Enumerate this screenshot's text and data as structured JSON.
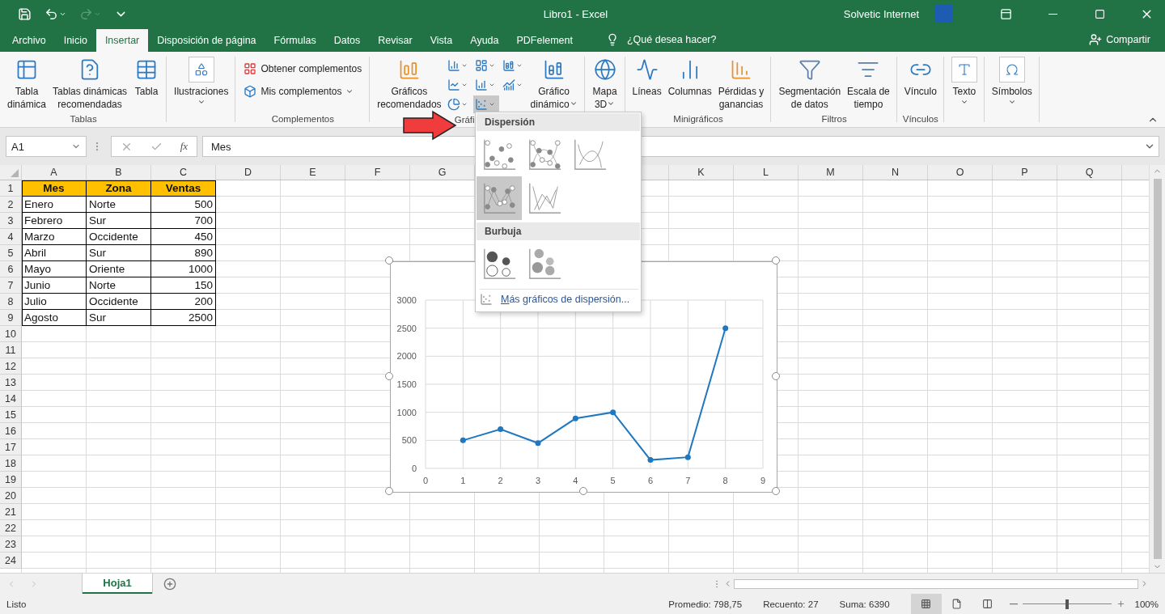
{
  "title_bar": {
    "title": "Libro1 - Excel",
    "user": "Solvetic Internet",
    "quick_access": [
      {
        "kind": "save",
        "disabled": false,
        "menu": false
      },
      {
        "kind": "undo",
        "disabled": false,
        "menu": true
      },
      {
        "kind": "redo",
        "disabled": true,
        "menu": true
      },
      {
        "kind": "customize",
        "disabled": false,
        "menu": false
      }
    ]
  },
  "tabs": [
    {
      "label": "Archivo",
      "selected": false
    },
    {
      "label": "Inicio",
      "selected": false
    },
    {
      "label": "Insertar",
      "selected": true
    },
    {
      "label": "Disposición de página",
      "selected": false
    },
    {
      "label": "Fórmulas",
      "selected": false
    },
    {
      "label": "Datos",
      "selected": false
    },
    {
      "label": "Revisar",
      "selected": false
    },
    {
      "label": "Vista",
      "selected": false
    },
    {
      "label": "Ayuda",
      "selected": false
    },
    {
      "label": "PDFelement",
      "selected": false
    }
  ],
  "tell_me": "¿Qué desea hacer?",
  "share": "Compartir",
  "ribbon": {
    "groups": [
      {
        "label": "Tablas",
        "items": [
          {
            "kind": "pivot-table",
            "label": "Tabla\ndinámica",
            "menu": false
          },
          {
            "kind": "recommended-pivot",
            "label": "Tablas dinámicas\nrecomendadas",
            "menu": false
          },
          {
            "kind": "table",
            "label": "Tabla",
            "menu": false
          }
        ]
      },
      {
        "items": [
          {
            "kind": "illustrations",
            "label": "Ilustraciones",
            "menu": true
          }
        ]
      },
      {
        "label": "Complementos",
        "items": [
          {
            "kind": "stack",
            "entries": [
              {
                "kind": "store",
                "label": "Obtener complementos",
                "menu": false
              },
              {
                "kind": "my-addins",
                "label": "Mis complementos",
                "menu": true
              }
            ]
          }
        ]
      },
      {
        "label": "Gráfi",
        "items": [
          {
            "kind": "recommended-charts",
            "label": "Gráficos\nrecomendados",
            "menu": false
          },
          {
            "kind": "chart-grid",
            "buttons": [
              {
                "kind": "column",
                "pressed": false
              },
              {
                "kind": "hierarchy",
                "pressed": false
              },
              {
                "kind": "waterfall",
                "pressed": false
              },
              {
                "kind": "line",
                "pressed": false
              },
              {
                "kind": "statistic",
                "pressed": false
              },
              {
                "kind": "combo",
                "pressed": false
              },
              {
                "kind": "pie",
                "pressed": false
              },
              {
                "kind": "scatter",
                "pressed": true
              }
            ]
          },
          {
            "kind": "pivot-chart",
            "label": "Gráfico\ndinámico",
            "menu": true
          }
        ]
      },
      {
        "items": [
          {
            "kind": "map-3d",
            "label": "Mapa\n3D",
            "menu": true
          }
        ]
      },
      {
        "label": "Minigráficos",
        "items": [
          {
            "kind": "sparkline-line",
            "label": "Líneas",
            "menu": false
          },
          {
            "kind": "sparkline-column",
            "label": "Columnas",
            "menu": false
          },
          {
            "kind": "win-loss",
            "label": "Pérdidas y\nganancias",
            "menu": false
          }
        ]
      },
      {
        "label": "Filtros",
        "items": [
          {
            "kind": "slicer",
            "label": "Segmentación\nde datos",
            "menu": false
          },
          {
            "kind": "timeline",
            "label": "Escala de\ntiempo",
            "menu": false
          }
        ]
      },
      {
        "label": "Vínculos",
        "items": [
          {
            "kind": "link",
            "label": "Vínculo",
            "menu": false
          }
        ]
      },
      {
        "items": [
          {
            "kind": "text",
            "label": "Texto",
            "menu": true
          }
        ]
      },
      {
        "items": [
          {
            "kind": "symbols",
            "label": "Símbolos",
            "menu": true
          }
        ]
      }
    ]
  },
  "formula_bar": {
    "name_box": "A1",
    "function_label": "fx",
    "value": "Mes"
  },
  "sheet": {
    "columns": [
      {
        "label": "A"
      },
      {
        "label": "B"
      },
      {
        "label": "C"
      },
      {
        "label": "D"
      },
      {
        "label": "E"
      },
      {
        "label": "F"
      },
      {
        "label": "G"
      },
      {},
      {},
      {},
      {
        "label": "K"
      },
      {
        "label": "L"
      },
      {
        "label": "M"
      },
      {
        "label": "N"
      },
      {
        "label": "O"
      },
      {
        "label": "P"
      },
      {
        "label": "Q"
      }
    ],
    "rows": [
      {
        "number": "1",
        "kind": "header",
        "cells": [
          "Mes",
          "Zona",
          "Ventas"
        ]
      },
      {
        "number": "2",
        "kind": "data",
        "cells": [
          "Enero",
          "Norte",
          "500"
        ]
      },
      {
        "number": "3",
        "kind": "data",
        "cells": [
          "Febrero",
          "Sur",
          "700"
        ]
      },
      {
        "number": "4",
        "kind": "data",
        "cells": [
          "Marzo",
          "Occidente",
          "450"
        ]
      },
      {
        "number": "5",
        "kind": "data",
        "cells": [
          "Abril",
          "Sur",
          "890"
        ]
      },
      {
        "number": "6",
        "kind": "data",
        "cells": [
          "Mayo",
          "Oriente",
          "1000"
        ]
      },
      {
        "number": "7",
        "kind": "data",
        "cells": [
          "Junio",
          "Norte",
          "150"
        ]
      },
      {
        "number": "8",
        "kind": "data",
        "cells": [
          "Julio",
          "Occidente",
          "200"
        ]
      },
      {
        "number": "9",
        "kind": "data",
        "cells": [
          "Agosto",
          "Sur",
          "2500"
        ]
      },
      {
        "number": "10"
      },
      {
        "number": "11"
      },
      {
        "number": "12"
      },
      {
        "number": "13"
      },
      {
        "number": "14"
      },
      {
        "number": "15"
      },
      {
        "number": "16"
      },
      {
        "number": "17"
      },
      {
        "number": "18"
      },
      {
        "number": "19"
      },
      {
        "number": "20"
      },
      {
        "number": "21"
      },
      {
        "number": "22"
      },
      {
        "number": "23"
      },
      {
        "number": "24"
      }
    ]
  },
  "chart": {
    "chart_data": {
      "type": "line",
      "x": [
        1,
        2,
        3,
        4,
        5,
        6,
        7,
        8
      ],
      "series": [
        {
          "color": "#1f77c0",
          "marker": true,
          "values": [
            500,
            700,
            450,
            890,
            1000,
            150,
            200,
            2500
          ]
        }
      ],
      "grid": true,
      "xlim": [
        0,
        9
      ],
      "ylim": [
        0,
        3000
      ],
      "xticks": [
        0,
        1,
        2,
        3,
        4,
        5,
        6,
        7,
        8,
        9
      ],
      "yticks": [
        0,
        500,
        1000,
        1500,
        2000,
        2500,
        3000
      ]
    }
  },
  "chart_menu": {
    "sections": [
      {
        "title": "Dispersión",
        "items": [
          {
            "kind": "scatter",
            "selected": false
          },
          {
            "kind": "smooth-markers",
            "selected": false
          },
          {
            "kind": "smooth",
            "selected": false
          },
          {
            "kind": "straight-markers",
            "selected": true
          },
          {
            "kind": "straight",
            "selected": false
          }
        ]
      },
      {
        "title": "Burbuja",
        "items": [
          {
            "kind": "bubble",
            "selected": false
          },
          {
            "kind": "bubble-3d",
            "selected": false
          }
        ]
      }
    ],
    "more": "Más gráficos de dispersión..."
  },
  "sheet_tabs": [
    {
      "label": "Hoja1",
      "selected": true
    }
  ],
  "status_bar": {
    "ready": "Listo",
    "stats": [
      "Promedio: 798,75",
      "Recuento: 27",
      "Suma: 6390"
    ],
    "views": [
      {
        "kind": "normal",
        "selected": true
      },
      {
        "kind": "page-layout",
        "selected": false
      },
      {
        "kind": "page-break",
        "selected": false
      }
    ],
    "zoom": {
      "level": 0.5,
      "label": "100%"
    }
  }
}
